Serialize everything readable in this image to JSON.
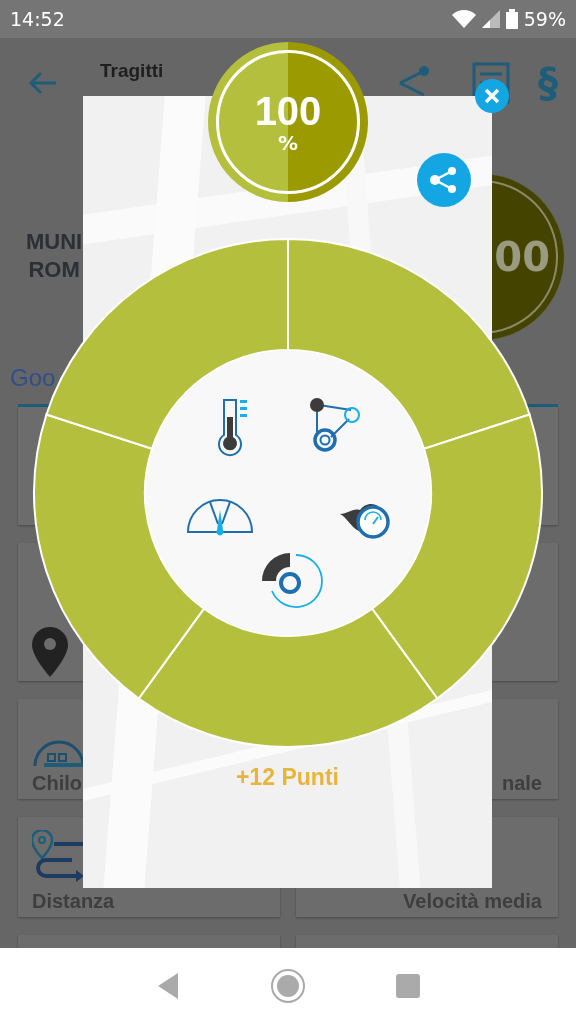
{
  "status_bar": {
    "time": "14:52",
    "battery": "59%"
  },
  "app_bar": {
    "title": "Tragitti",
    "section_symbol": "§"
  },
  "background": {
    "header_lines": [
      "MUNI",
      "ROM"
    ],
    "score_badge": "00",
    "map_logo": "Goo",
    "cards": [
      {
        "kind": "blank"
      },
      {
        "kind": "blank"
      },
      {
        "kind": "pin"
      },
      {
        "kind": "blank"
      },
      {
        "kind": "speedometer",
        "label": "Chilo"
      },
      {
        "kind": "blank",
        "label": "nale"
      },
      {
        "kind": "route",
        "label": "Distanza"
      },
      {
        "kind": "blank",
        "label": "Velocità media"
      },
      {
        "kind": "blank"
      },
      {
        "kind": "blank"
      }
    ]
  },
  "dialog": {
    "score": {
      "value": "100",
      "unit": "%"
    },
    "wheel": {
      "segments": [
        {
          "kind": "belt"
        },
        {
          "kind": "flame-gauge"
        },
        {
          "kind": "brake"
        },
        {
          "kind": "dial"
        },
        {
          "kind": "thermometer"
        }
      ]
    },
    "points": "+12 Punti"
  }
}
